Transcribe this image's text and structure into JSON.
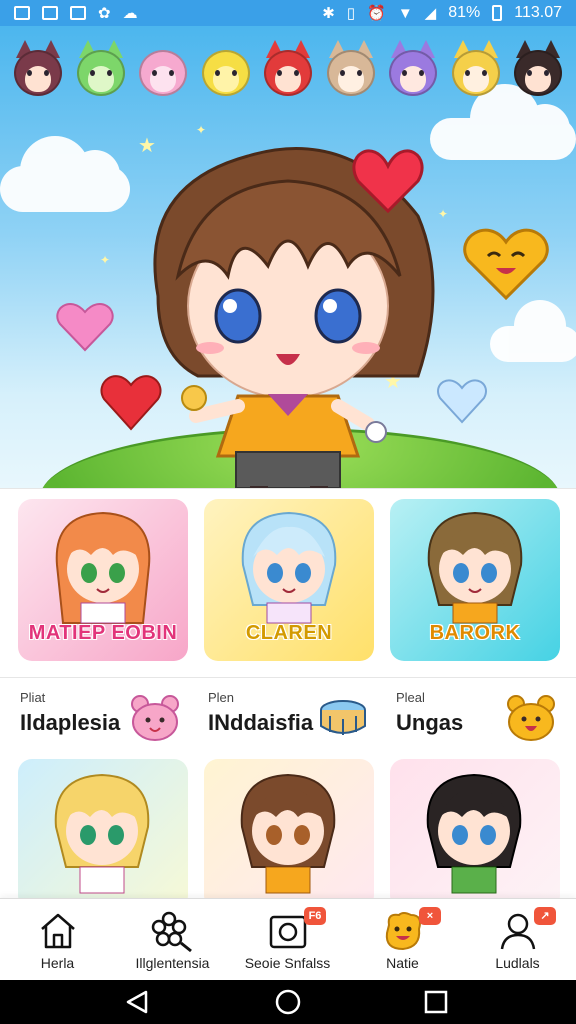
{
  "status_bar": {
    "battery": "81%",
    "time": "113.07",
    "left_icons": [
      "image-icon",
      "image-icon",
      "image-icon",
      "settings-icon",
      "cloud-icon"
    ],
    "right_icons": [
      "bluetooth-icon",
      "vibrate-icon",
      "alarm-icon",
      "wifi-icon",
      "signal-icon",
      "battery-icon"
    ]
  },
  "hero": {
    "avatar_colors": [
      "#7a3a4a",
      "#7dd66a",
      "#f6a9cf",
      "#f6de44",
      "#e23b3b",
      "#d8b898",
      "#9b7ae0",
      "#f5d04a",
      "#3a2a2a"
    ]
  },
  "character_cards": [
    {
      "title": "MATIEP EOBIN"
    },
    {
      "title": "CLAREN"
    },
    {
      "title": "BARORK"
    }
  ],
  "featured": [
    {
      "sub": "Pliat",
      "main": "Ildaplesia"
    },
    {
      "sub": "Plen",
      "main": "INddaisfia"
    },
    {
      "sub": "Pleal",
      "main": "Ungas"
    }
  ],
  "bottom_nav": [
    {
      "label": "Herla",
      "icon": "home-icon"
    },
    {
      "label": "Illglentensia",
      "icon": "flower-search-icon"
    },
    {
      "label": "Seoie Snfalss",
      "icon": "camera-icon",
      "badge": "F6"
    },
    {
      "label": "Natie",
      "icon": "emoji-icon",
      "badge": "×"
    },
    {
      "label": "Ludlals",
      "icon": "profile-icon",
      "badge": "↗"
    }
  ],
  "colors": {
    "status_bar": "#3aa0e8",
    "accent_badge": "#f0553b"
  }
}
